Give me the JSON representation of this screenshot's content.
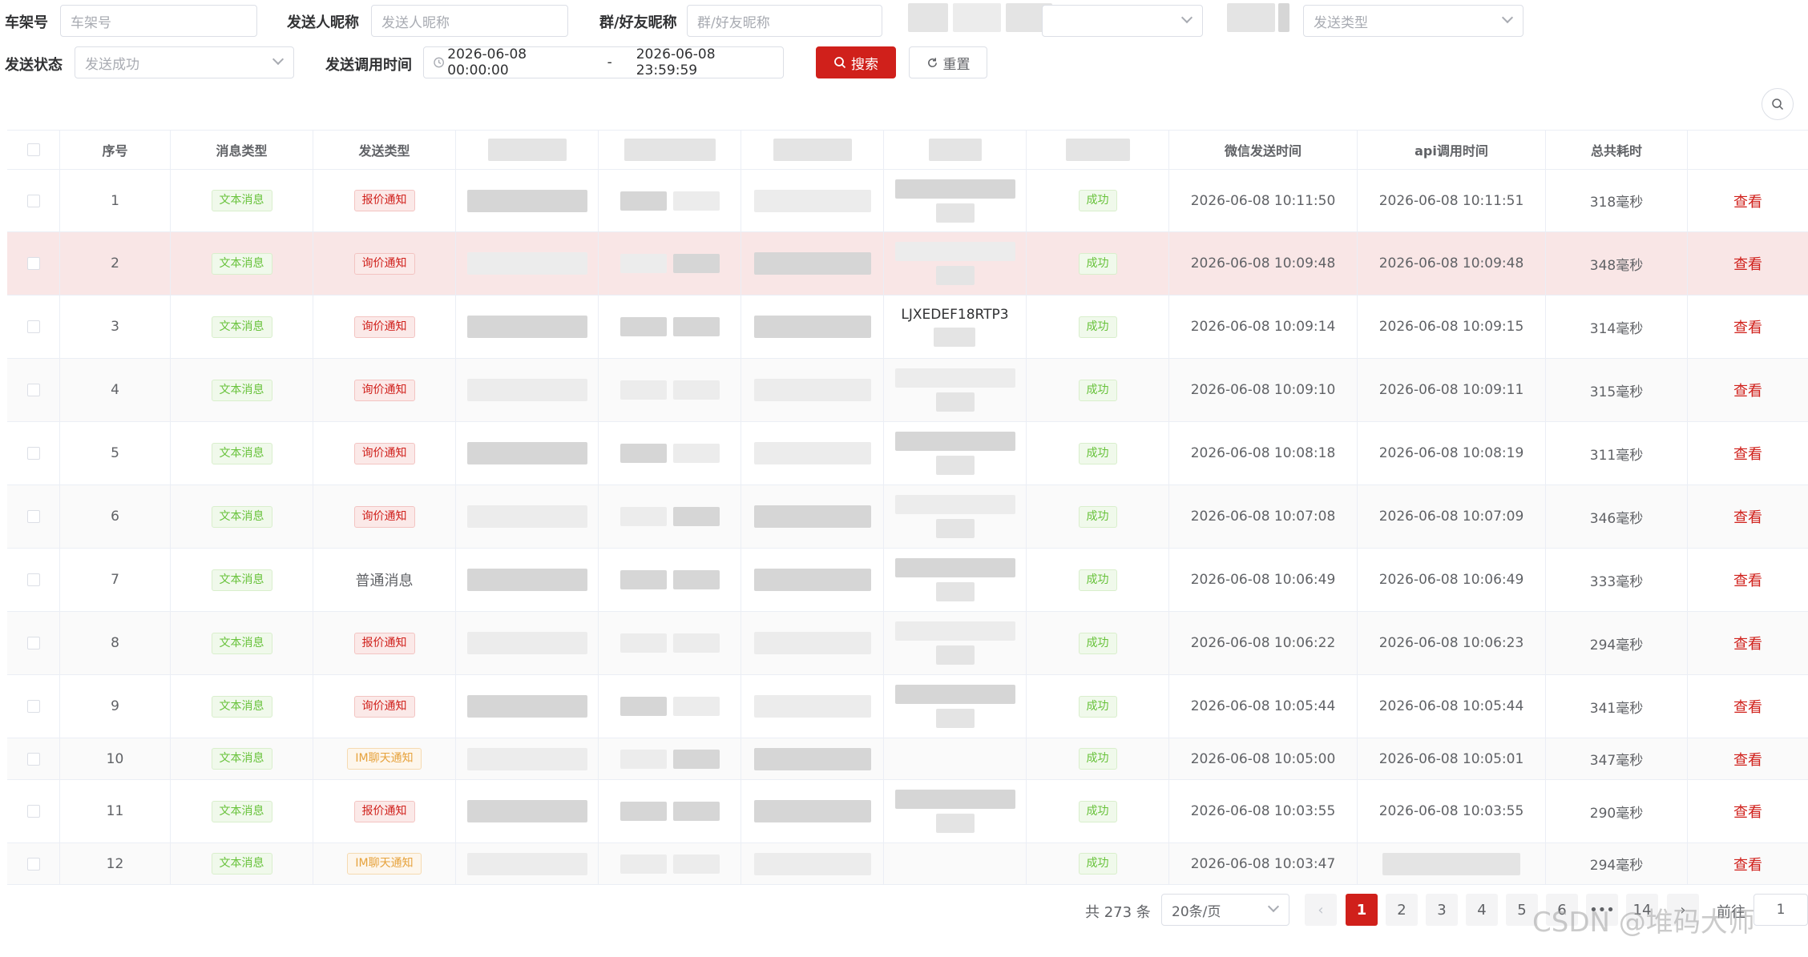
{
  "filters": {
    "vin_label": "车架号",
    "vin_placeholder": "车架号",
    "sender_label": "发送人昵称",
    "sender_placeholder": "发送人昵称",
    "group_label": "群/好友昵称",
    "group_placeholder": "群/好友昵称",
    "send_type_placeholder": "发送类型",
    "status_label": "发送状态",
    "status_placeholder": "发送成功",
    "time_label": "发送调用时间",
    "time_start": "2026-06-08 00:00:00",
    "time_sep": "-",
    "time_end": "2026-06-08 23:59:59",
    "search_label": "搜索",
    "reset_label": "重置"
  },
  "table": {
    "headers": {
      "index": "序号",
      "msg_type": "消息类型",
      "send_type": "发送类型",
      "wx_time": "微信发送时间",
      "api_time": "api调用时间",
      "duration": "总共耗时"
    },
    "action_label": "查看",
    "rows": [
      {
        "index": "1",
        "msg_type": "文本消息",
        "send_type": "报价通知",
        "send_type_style": "red",
        "vin": "",
        "status": "成功",
        "wx_time": "2026-06-08 10:11:50",
        "api_time": "2026-06-08 10:11:51",
        "duration": "318毫秒"
      },
      {
        "index": "2",
        "msg_type": "文本消息",
        "send_type": "询价通知",
        "send_type_style": "red",
        "vin": "",
        "status": "成功",
        "wx_time": "2026-06-08 10:09:48",
        "api_time": "2026-06-08 10:09:48",
        "duration": "348毫秒"
      },
      {
        "index": "3",
        "msg_type": "文本消息",
        "send_type": "询价通知",
        "send_type_style": "red",
        "vin": "LJXEDEF18RTP3",
        "status": "成功",
        "wx_time": "2026-06-08 10:09:14",
        "api_time": "2026-06-08 10:09:15",
        "duration": "314毫秒"
      },
      {
        "index": "4",
        "msg_type": "文本消息",
        "send_type": "询价通知",
        "send_type_style": "red",
        "vin": "",
        "status": "成功",
        "wx_time": "2026-06-08 10:09:10",
        "api_time": "2026-06-08 10:09:11",
        "duration": "315毫秒"
      },
      {
        "index": "5",
        "msg_type": "文本消息",
        "send_type": "询价通知",
        "send_type_style": "red",
        "vin": "",
        "status": "成功",
        "wx_time": "2026-06-08 10:08:18",
        "api_time": "2026-06-08 10:08:19",
        "duration": "311毫秒"
      },
      {
        "index": "6",
        "msg_type": "文本消息",
        "send_type": "询价通知",
        "send_type_style": "red",
        "vin": "",
        "status": "成功",
        "wx_time": "2026-06-08 10:07:08",
        "api_time": "2026-06-08 10:07:09",
        "duration": "346毫秒"
      },
      {
        "index": "7",
        "msg_type": "文本消息",
        "send_type": "普通消息",
        "send_type_style": "plain",
        "vin": "",
        "status": "成功",
        "wx_time": "2026-06-08 10:06:49",
        "api_time": "2026-06-08 10:06:49",
        "duration": "333毫秒"
      },
      {
        "index": "8",
        "msg_type": "文本消息",
        "send_type": "报价通知",
        "send_type_style": "red",
        "vin": "",
        "status": "成功",
        "wx_time": "2026-06-08 10:06:22",
        "api_time": "2026-06-08 10:06:23",
        "duration": "294毫秒"
      },
      {
        "index": "9",
        "msg_type": "文本消息",
        "send_type": "询价通知",
        "send_type_style": "red",
        "vin": "",
        "status": "成功",
        "wx_time": "2026-06-08 10:05:44",
        "api_time": "2026-06-08 10:05:44",
        "duration": "341毫秒"
      },
      {
        "index": "10",
        "msg_type": "文本消息",
        "send_type": "IM聊天通知",
        "send_type_style": "orange",
        "vin": "",
        "status": "成功",
        "wx_time": "2026-06-08 10:05:00",
        "api_time": "2026-06-08 10:05:01",
        "duration": "347毫秒"
      },
      {
        "index": "11",
        "msg_type": "文本消息",
        "send_type": "报价通知",
        "send_type_style": "red",
        "vin": "",
        "status": "成功",
        "wx_time": "2026-06-08 10:03:55",
        "api_time": "2026-06-08 10:03:55",
        "duration": "290毫秒"
      },
      {
        "index": "12",
        "msg_type": "文本消息",
        "send_type": "IM聊天通知",
        "send_type_style": "orange",
        "vin": "",
        "status": "成功",
        "wx_time": "2026-06-08 10:03:47",
        "api_time": "",
        "duration": "294毫秒"
      }
    ]
  },
  "pagination": {
    "total": "共 273 条",
    "page_size": "20条/页",
    "pages": [
      "1",
      "2",
      "3",
      "4",
      "5",
      "6",
      "•••",
      "14"
    ],
    "current": "1",
    "goto_label": "前往",
    "goto_value": "1"
  },
  "watermark": "CSDN @堆码大师",
  "colors": {
    "accent": "#d0201b",
    "success": "#67c23a",
    "warning": "#e6a23c"
  }
}
